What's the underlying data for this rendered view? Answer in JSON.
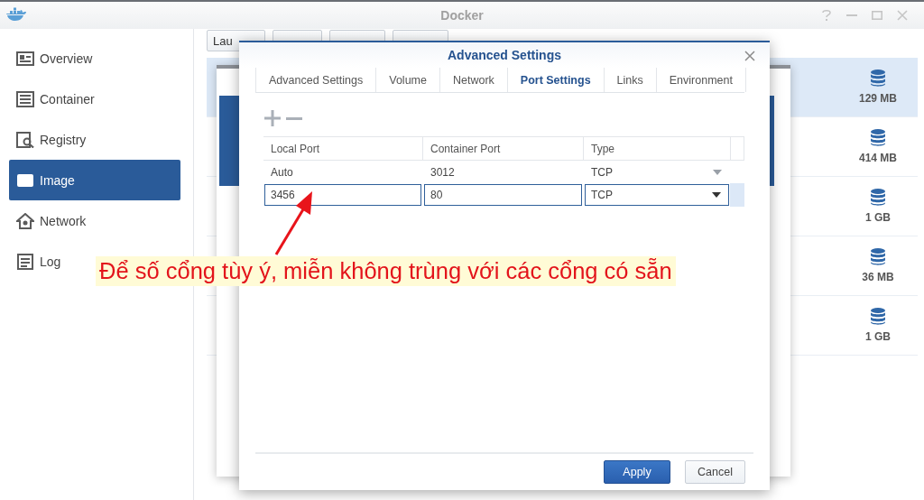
{
  "window": {
    "title": "Docker"
  },
  "sidebar": {
    "items": [
      {
        "label": "Overview",
        "kind": "overview",
        "selected": false
      },
      {
        "label": "Container",
        "kind": "container",
        "selected": false
      },
      {
        "label": "Registry",
        "kind": "registry",
        "selected": false
      },
      {
        "label": "Image",
        "kind": "image",
        "selected": true
      },
      {
        "label": "Network",
        "kind": "network",
        "selected": false
      },
      {
        "label": "Log",
        "kind": "log",
        "selected": false
      }
    ]
  },
  "toolbar": {
    "buttons": [
      {
        "label": "Lau"
      }
    ]
  },
  "images": {
    "rows": [
      {
        "size": "129 MB",
        "selected": true
      },
      {
        "size": "414 MB",
        "selected": false
      },
      {
        "size": "1 GB",
        "selected": false
      },
      {
        "size": "36 MB",
        "selected": false
      },
      {
        "size": "1 GB",
        "selected": false
      }
    ]
  },
  "dialog": {
    "title": "Advanced Settings",
    "tabs": [
      {
        "label": "Advanced Settings",
        "selected": false
      },
      {
        "label": "Volume",
        "selected": false
      },
      {
        "label": "Network",
        "selected": false
      },
      {
        "label": "Port Settings",
        "selected": true
      },
      {
        "label": "Links",
        "selected": false
      },
      {
        "label": "Environment",
        "selected": false
      }
    ],
    "table": {
      "columns": [
        "Local Port",
        "Container Port",
        "Type"
      ],
      "rows": [
        {
          "local_port": "Auto",
          "container_port": "3012",
          "type": "TCP",
          "editing": false
        },
        {
          "local_port": "3456",
          "container_port": "80",
          "type": "TCP",
          "editing": true
        }
      ]
    },
    "buttons": [
      {
        "label": "Apply",
        "kind": "primary"
      },
      {
        "label": "Cancel",
        "kind": "secondary"
      }
    ]
  },
  "annotation": {
    "text": "Để số cổng tùy ý, miễn không trùng với các cổng có sẵn"
  }
}
